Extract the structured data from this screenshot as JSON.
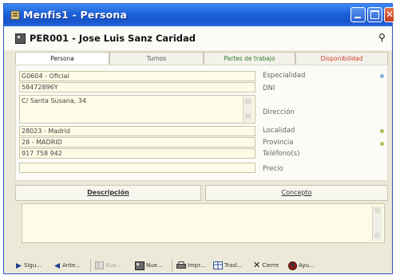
{
  "window": {
    "title": "Menfis1 - Persona"
  },
  "record": {
    "title": "PER001 - Jose Luis Sanz Caridad"
  },
  "tabs": [
    "Persona",
    "Turnos",
    "Partes de trabajo",
    "Disponibilidad"
  ],
  "fields": {
    "especialidad": {
      "value": "G0604 - Oficial",
      "label": "Especialidad"
    },
    "dni": {
      "value": "58472896Y",
      "label": "DNI"
    },
    "direccion": {
      "value": "C/ Santa Susana, 34",
      "label": "Dirección"
    },
    "localidad": {
      "value": "28023 - Madrid",
      "label": "Localidad"
    },
    "provincia": {
      "value": "28 - MADRID",
      "label": "Provincia"
    },
    "telefono": {
      "value": "917 758 942",
      "label": "Teléfono(s)"
    },
    "precio": {
      "value": "",
      "label": "Precio"
    }
  },
  "lower_tabs": [
    "Descripción",
    "Concepto"
  ],
  "toolbar": {
    "siguiente": "Sigu...",
    "anterior": "Ante...",
    "nuevo_disabled": "Nue...",
    "nuevo": "Nue...",
    "imprimir": "Impr...",
    "traslado": "Trasl...",
    "cierre": "Cierre",
    "ayuda": "Ayu..."
  },
  "colors": {
    "titlebar": "#1c5fd8",
    "field_bg": "#fdfce6",
    "dot_blue": "#7fb2d8",
    "dot_green": "#a8c25a",
    "tab_green": "#2e7a2e",
    "tab_red": "#d23a2b"
  }
}
